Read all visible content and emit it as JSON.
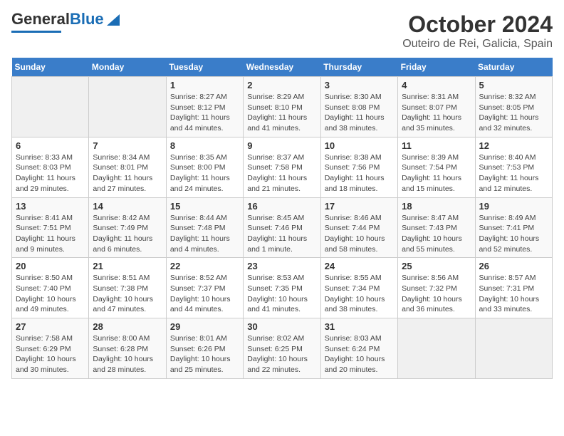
{
  "header": {
    "logo_general": "General",
    "logo_blue": "Blue",
    "title": "October 2024",
    "subtitle": "Outeiro de Rei, Galicia, Spain"
  },
  "weekdays": [
    "Sunday",
    "Monday",
    "Tuesday",
    "Wednesday",
    "Thursday",
    "Friday",
    "Saturday"
  ],
  "weeks": [
    [
      {
        "day": "",
        "info": ""
      },
      {
        "day": "",
        "info": ""
      },
      {
        "day": "1",
        "info": "Sunrise: 8:27 AM\nSunset: 8:12 PM\nDaylight: 11 hours and 44 minutes."
      },
      {
        "day": "2",
        "info": "Sunrise: 8:29 AM\nSunset: 8:10 PM\nDaylight: 11 hours and 41 minutes."
      },
      {
        "day": "3",
        "info": "Sunrise: 8:30 AM\nSunset: 8:08 PM\nDaylight: 11 hours and 38 minutes."
      },
      {
        "day": "4",
        "info": "Sunrise: 8:31 AM\nSunset: 8:07 PM\nDaylight: 11 hours and 35 minutes."
      },
      {
        "day": "5",
        "info": "Sunrise: 8:32 AM\nSunset: 8:05 PM\nDaylight: 11 hours and 32 minutes."
      }
    ],
    [
      {
        "day": "6",
        "info": "Sunrise: 8:33 AM\nSunset: 8:03 PM\nDaylight: 11 hours and 29 minutes."
      },
      {
        "day": "7",
        "info": "Sunrise: 8:34 AM\nSunset: 8:01 PM\nDaylight: 11 hours and 27 minutes."
      },
      {
        "day": "8",
        "info": "Sunrise: 8:35 AM\nSunset: 8:00 PM\nDaylight: 11 hours and 24 minutes."
      },
      {
        "day": "9",
        "info": "Sunrise: 8:37 AM\nSunset: 7:58 PM\nDaylight: 11 hours and 21 minutes."
      },
      {
        "day": "10",
        "info": "Sunrise: 8:38 AM\nSunset: 7:56 PM\nDaylight: 11 hours and 18 minutes."
      },
      {
        "day": "11",
        "info": "Sunrise: 8:39 AM\nSunset: 7:54 PM\nDaylight: 11 hours and 15 minutes."
      },
      {
        "day": "12",
        "info": "Sunrise: 8:40 AM\nSunset: 7:53 PM\nDaylight: 11 hours and 12 minutes."
      }
    ],
    [
      {
        "day": "13",
        "info": "Sunrise: 8:41 AM\nSunset: 7:51 PM\nDaylight: 11 hours and 9 minutes."
      },
      {
        "day": "14",
        "info": "Sunrise: 8:42 AM\nSunset: 7:49 PM\nDaylight: 11 hours and 6 minutes."
      },
      {
        "day": "15",
        "info": "Sunrise: 8:44 AM\nSunset: 7:48 PM\nDaylight: 11 hours and 4 minutes."
      },
      {
        "day": "16",
        "info": "Sunrise: 8:45 AM\nSunset: 7:46 PM\nDaylight: 11 hours and 1 minute."
      },
      {
        "day": "17",
        "info": "Sunrise: 8:46 AM\nSunset: 7:44 PM\nDaylight: 10 hours and 58 minutes."
      },
      {
        "day": "18",
        "info": "Sunrise: 8:47 AM\nSunset: 7:43 PM\nDaylight: 10 hours and 55 minutes."
      },
      {
        "day": "19",
        "info": "Sunrise: 8:49 AM\nSunset: 7:41 PM\nDaylight: 10 hours and 52 minutes."
      }
    ],
    [
      {
        "day": "20",
        "info": "Sunrise: 8:50 AM\nSunset: 7:40 PM\nDaylight: 10 hours and 49 minutes."
      },
      {
        "day": "21",
        "info": "Sunrise: 8:51 AM\nSunset: 7:38 PM\nDaylight: 10 hours and 47 minutes."
      },
      {
        "day": "22",
        "info": "Sunrise: 8:52 AM\nSunset: 7:37 PM\nDaylight: 10 hours and 44 minutes."
      },
      {
        "day": "23",
        "info": "Sunrise: 8:53 AM\nSunset: 7:35 PM\nDaylight: 10 hours and 41 minutes."
      },
      {
        "day": "24",
        "info": "Sunrise: 8:55 AM\nSunset: 7:34 PM\nDaylight: 10 hours and 38 minutes."
      },
      {
        "day": "25",
        "info": "Sunrise: 8:56 AM\nSunset: 7:32 PM\nDaylight: 10 hours and 36 minutes."
      },
      {
        "day": "26",
        "info": "Sunrise: 8:57 AM\nSunset: 7:31 PM\nDaylight: 10 hours and 33 minutes."
      }
    ],
    [
      {
        "day": "27",
        "info": "Sunrise: 7:58 AM\nSunset: 6:29 PM\nDaylight: 10 hours and 30 minutes."
      },
      {
        "day": "28",
        "info": "Sunrise: 8:00 AM\nSunset: 6:28 PM\nDaylight: 10 hours and 28 minutes."
      },
      {
        "day": "29",
        "info": "Sunrise: 8:01 AM\nSunset: 6:26 PM\nDaylight: 10 hours and 25 minutes."
      },
      {
        "day": "30",
        "info": "Sunrise: 8:02 AM\nSunset: 6:25 PM\nDaylight: 10 hours and 22 minutes."
      },
      {
        "day": "31",
        "info": "Sunrise: 8:03 AM\nSunset: 6:24 PM\nDaylight: 10 hours and 20 minutes."
      },
      {
        "day": "",
        "info": ""
      },
      {
        "day": "",
        "info": ""
      }
    ]
  ]
}
